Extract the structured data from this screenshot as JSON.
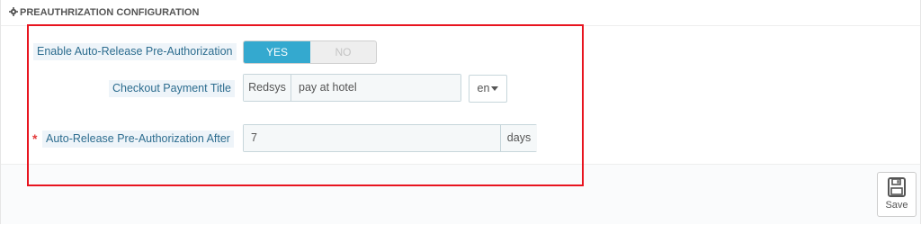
{
  "panel": {
    "title": "PREAUTHRIZATION CONFIGURATION",
    "title_icon": "gear-icon"
  },
  "form": {
    "auto_release": {
      "label": "Enable Auto-Release Pre-Authorization",
      "yes_label": "YES",
      "no_label": "NO",
      "value": "YES"
    },
    "checkout_title": {
      "label": "Checkout Payment Title",
      "prefix": "Redsys",
      "value": "pay at hotel",
      "language": "en"
    },
    "release_after": {
      "label": "Auto-Release Pre-Authorization After",
      "required_mark": "*",
      "value": "7",
      "suffix": "days"
    }
  },
  "footer": {
    "save_label": "Save",
    "save_icon": "floppy-disk-icon"
  },
  "colors": {
    "accent": "#34a9cf",
    "label_text": "#2d6d8f",
    "label_bg": "#eef4f9",
    "required": "#e43d3d",
    "highlight": "#e8141f"
  }
}
